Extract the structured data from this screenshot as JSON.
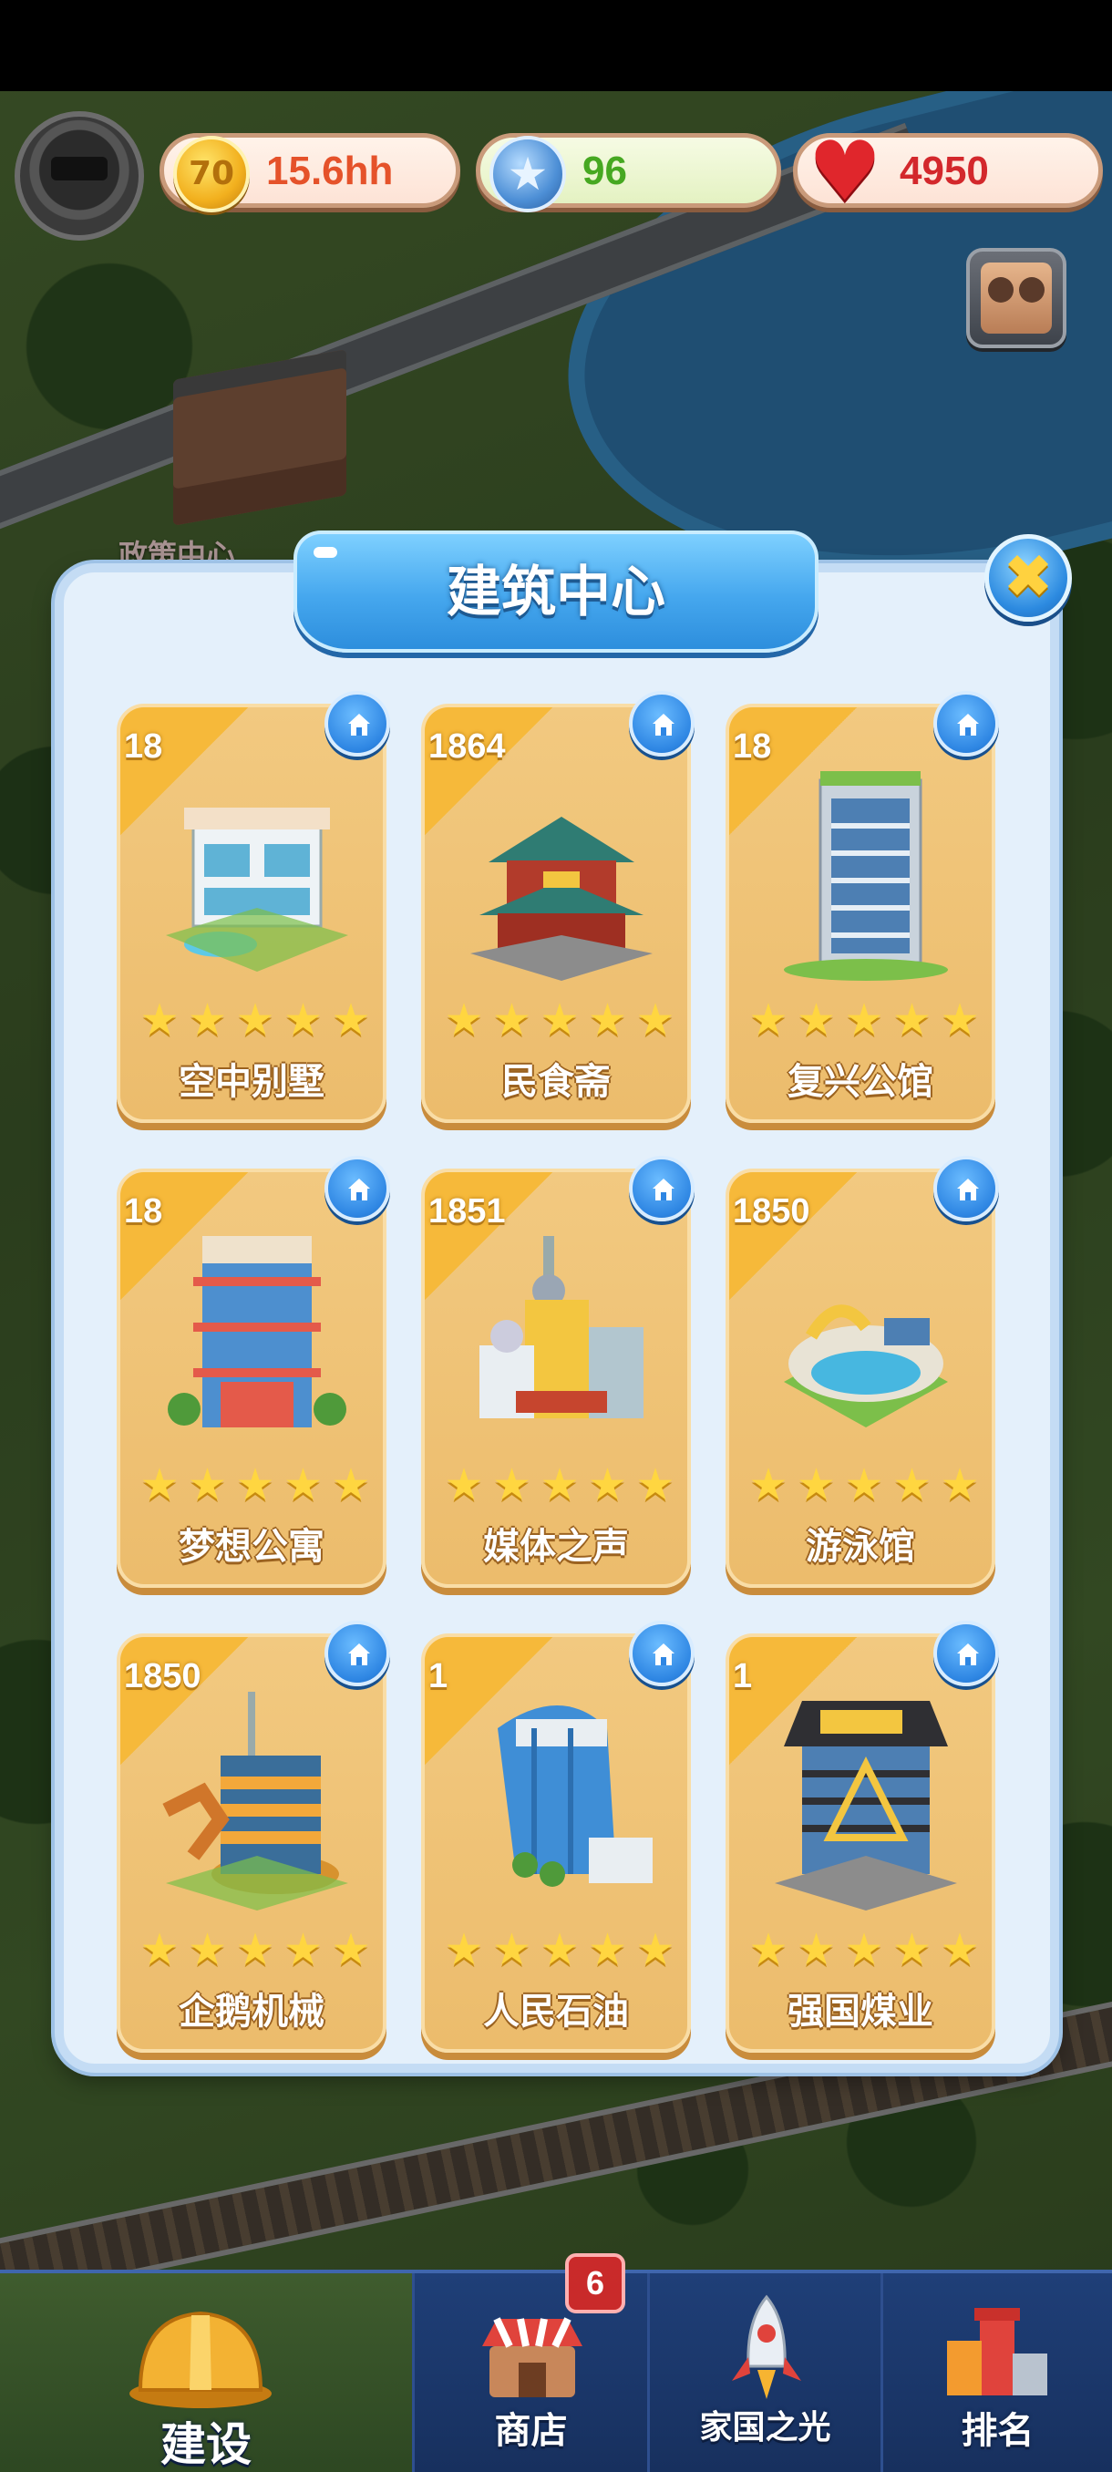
{
  "hud": {
    "gold": "15.6hh",
    "coin_symbol": "70",
    "stars": "96",
    "hearts": "4950",
    "gold_color": "#e5522a",
    "stars_color": "#46a821",
    "hearts_color": "#d3282c"
  },
  "background_label": "政策中心",
  "modal": {
    "title": "建筑中心",
    "close_symbol": "✖"
  },
  "buildings": [
    {
      "year": "18",
      "name": "空中别墅",
      "stars": 5,
      "kind": "villa"
    },
    {
      "year": "1864",
      "name": "民食斋",
      "stars": 5,
      "kind": "temple"
    },
    {
      "year": "18",
      "name": "复兴公馆",
      "stars": 5,
      "kind": "tower"
    },
    {
      "year": "18",
      "name": "梦想公寓",
      "stars": 5,
      "kind": "apartment"
    },
    {
      "year": "1851",
      "name": "媒体之声",
      "stars": 5,
      "kind": "media"
    },
    {
      "year": "1850",
      "name": "游泳馆",
      "stars": 5,
      "kind": "pool"
    },
    {
      "year": "1850",
      "name": "企鹅机械",
      "stars": 5,
      "kind": "factory"
    },
    {
      "year": "1",
      "name": "人民石油",
      "stars": 5,
      "kind": "oil"
    },
    {
      "year": "1",
      "name": "强国煤业",
      "stars": 5,
      "kind": "coal"
    }
  ],
  "nav": {
    "tabs": [
      {
        "label": "建设",
        "icon": "hardhat-icon",
        "active": true
      },
      {
        "label": "商店",
        "icon": "shop-icon",
        "active": false
      },
      {
        "label": "家国之光",
        "icon": "rocket-icon",
        "active": false
      },
      {
        "label": "排名",
        "icon": "podium-icon",
        "active": false
      }
    ],
    "shop_badge": "6"
  },
  "colors": {
    "card": "#ecbc6c",
    "modal": "#e4f0fb",
    "title_blue": "#45a7ee",
    "nav": "#1f3f78"
  }
}
